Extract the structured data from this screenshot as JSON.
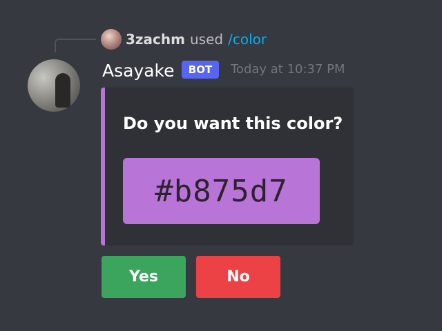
{
  "interaction": {
    "user": "3zachm",
    "used_text": "used",
    "command": "/color"
  },
  "message": {
    "author": "Asayake",
    "bot_tag": "BOT",
    "timestamp": "Today at 10:37 PM"
  },
  "embed": {
    "title": "Do you want this color?",
    "color_hex": "#b875d7",
    "accent_color": "#b875d7"
  },
  "buttons": {
    "yes": "Yes",
    "no": "No"
  },
  "colors": {
    "background": "#36393f",
    "embed_bg": "#2f3136",
    "bot_tag": "#5865f2",
    "success": "#3ba55d",
    "danger": "#ed4245",
    "command_link": "#00aff4"
  }
}
